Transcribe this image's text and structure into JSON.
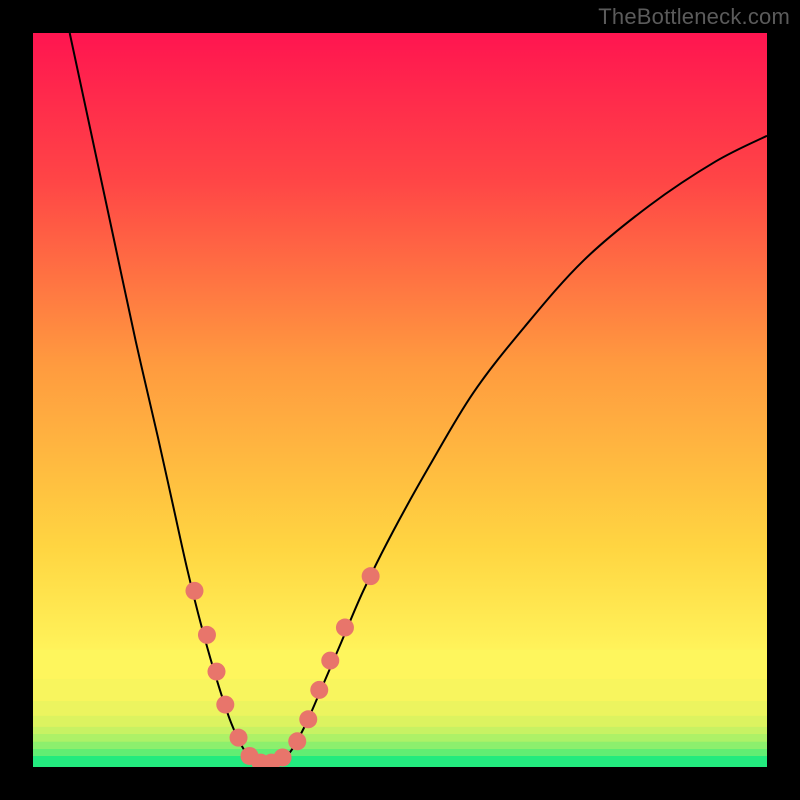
{
  "watermark": "TheBottleneck.com",
  "chart_data": {
    "type": "line",
    "title": "",
    "xlabel": "",
    "ylabel": "",
    "xlim": [
      0,
      100
    ],
    "ylim": [
      0,
      100
    ],
    "grid": false,
    "curve": {
      "name": "bottleneck-curve",
      "stroke": "#000000",
      "stroke_width": 2,
      "points": [
        {
          "x": 5.0,
          "y": 100.0
        },
        {
          "x": 8.0,
          "y": 86.0
        },
        {
          "x": 11.0,
          "y": 72.0
        },
        {
          "x": 14.0,
          "y": 58.0
        },
        {
          "x": 17.0,
          "y": 45.0
        },
        {
          "x": 19.0,
          "y": 36.0
        },
        {
          "x": 21.0,
          "y": 27.0
        },
        {
          "x": 23.0,
          "y": 19.0
        },
        {
          "x": 25.0,
          "y": 12.0
        },
        {
          "x": 27.0,
          "y": 6.0
        },
        {
          "x": 29.0,
          "y": 2.0
        },
        {
          "x": 31.0,
          "y": 0.5
        },
        {
          "x": 33.0,
          "y": 0.5
        },
        {
          "x": 35.0,
          "y": 2.0
        },
        {
          "x": 37.0,
          "y": 5.5
        },
        {
          "x": 39.0,
          "y": 10.0
        },
        {
          "x": 42.0,
          "y": 17.0
        },
        {
          "x": 45.0,
          "y": 24.0
        },
        {
          "x": 49.0,
          "y": 32.0
        },
        {
          "x": 54.0,
          "y": 41.0
        },
        {
          "x": 60.0,
          "y": 51.0
        },
        {
          "x": 67.0,
          "y": 60.0
        },
        {
          "x": 75.0,
          "y": 69.0
        },
        {
          "x": 84.0,
          "y": 76.5
        },
        {
          "x": 93.0,
          "y": 82.5
        },
        {
          "x": 100.0,
          "y": 86.0
        }
      ]
    },
    "markers": {
      "name": "highlight-points",
      "fill": "#e8756b",
      "radius": 9,
      "points": [
        {
          "x": 22.0,
          "y": 24.0
        },
        {
          "x": 23.7,
          "y": 18.0
        },
        {
          "x": 25.0,
          "y": 13.0
        },
        {
          "x": 26.2,
          "y": 8.5
        },
        {
          "x": 28.0,
          "y": 4.0
        },
        {
          "x": 29.5,
          "y": 1.5
        },
        {
          "x": 31.0,
          "y": 0.6
        },
        {
          "x": 32.5,
          "y": 0.6
        },
        {
          "x": 34.0,
          "y": 1.3
        },
        {
          "x": 36.0,
          "y": 3.5
        },
        {
          "x": 37.5,
          "y": 6.5
        },
        {
          "x": 39.0,
          "y": 10.5
        },
        {
          "x": 40.5,
          "y": 14.5
        },
        {
          "x": 42.5,
          "y": 19.0
        },
        {
          "x": 46.0,
          "y": 26.0
        }
      ]
    },
    "bands": [
      {
        "y_from": 0.0,
        "y_to": 1.5,
        "color": "#23ea7e"
      },
      {
        "y_from": 1.5,
        "y_to": 2.5,
        "color": "#62ed73"
      },
      {
        "y_from": 2.5,
        "y_to": 3.5,
        "color": "#8cef6d"
      },
      {
        "y_from": 3.5,
        "y_to": 4.5,
        "color": "#adf167"
      },
      {
        "y_from": 4.5,
        "y_to": 5.5,
        "color": "#c7f263"
      },
      {
        "y_from": 5.5,
        "y_to": 7.0,
        "color": "#dcf360"
      },
      {
        "y_from": 7.0,
        "y_to": 9.0,
        "color": "#ecf45f"
      },
      {
        "y_from": 9.0,
        "y_to": 12.0,
        "color": "#f8f55e"
      },
      {
        "y_from": 12.0,
        "y_to": 16.0,
        "color": "#fef65d"
      }
    ],
    "gradient_stops": [
      {
        "offset": 0,
        "color": "#ff1550"
      },
      {
        "offset": 20,
        "color": "#ff4546"
      },
      {
        "offset": 45,
        "color": "#ff9a3f"
      },
      {
        "offset": 70,
        "color": "#ffd541"
      },
      {
        "offset": 84,
        "color": "#fff35a"
      },
      {
        "offset": 100,
        "color": "#fff35a"
      }
    ]
  }
}
